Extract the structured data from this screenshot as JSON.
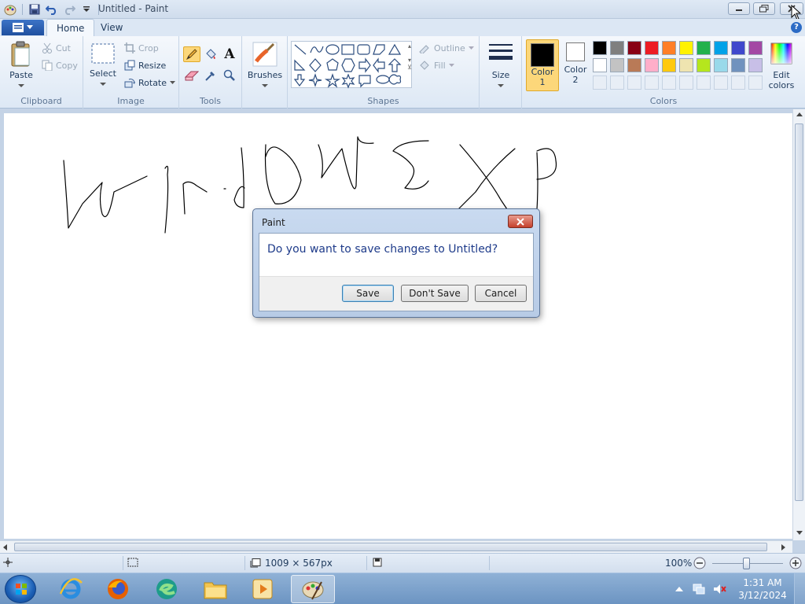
{
  "window": {
    "title": "Untitled - Paint"
  },
  "tabs": [
    {
      "label": "Home"
    },
    {
      "label": "View"
    }
  ],
  "clipboard": {
    "paste": "Paste",
    "cut": "Cut",
    "copy": "Copy",
    "group": "Clipboard"
  },
  "image": {
    "select": "Select",
    "crop": "Crop",
    "resize": "Resize",
    "rotate": "Rotate",
    "group": "Image"
  },
  "tools": {
    "group": "Tools",
    "text_glyph": "A"
  },
  "brushes": {
    "label": "Brushes"
  },
  "shapes": {
    "outline": "Outline",
    "fill": "Fill",
    "group": "Shapes"
  },
  "size": {
    "label": "Size"
  },
  "colors": {
    "color1": "Color\n1",
    "color1_line1": "Color",
    "color1_line2": "1",
    "color2_line1": "Color",
    "color2_line2": "2",
    "edit_line1": "Edit",
    "edit_line2": "colors",
    "group": "Colors",
    "color1_value": "#000000",
    "color2_value": "#ffffff",
    "row1": [
      "#000000",
      "#7f7f7f",
      "#880015",
      "#ed1c24",
      "#ff7f27",
      "#fff200",
      "#22b14c",
      "#00a2e8",
      "#3f48cc",
      "#a349a4"
    ],
    "row2": [
      "#ffffff",
      "#c3c3c3",
      "#b97a57",
      "#ffaec9",
      "#ffc90e",
      "#efe4b0",
      "#b5e61d",
      "#99d9ea",
      "#7092be",
      "#c8bfe7"
    ]
  },
  "status": {
    "canvas_size": "1009 × 567px",
    "zoom": "100%"
  },
  "dialog": {
    "title": "Paint",
    "message": "Do you want to save changes to Untitled?",
    "save": "Save",
    "dont_save": "Don't Save",
    "cancel": "Cancel"
  },
  "taskbar": {
    "time": "1:31 AM",
    "date": "3/12/2024"
  }
}
